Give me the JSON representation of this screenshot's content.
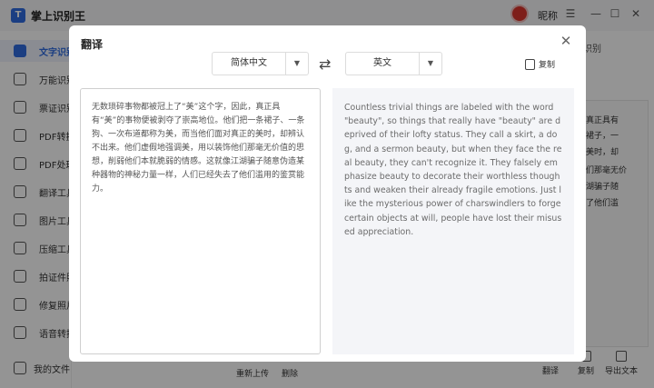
{
  "app": {
    "logo_char": "T",
    "title": "掌上识别王",
    "nickname": "昵称",
    "window_buttons": [
      "☰",
      "—",
      "☐",
      "✕"
    ]
  },
  "sidebar": {
    "items": [
      {
        "label": "文字识别",
        "icon": "text-recognition-icon",
        "active": true
      },
      {
        "label": "万能识别",
        "icon": "universal-scan-icon"
      },
      {
        "label": "票证识别",
        "icon": "ticket-icon"
      },
      {
        "label": "PDF转换",
        "icon": "pdf-convert-icon"
      },
      {
        "label": "PDF处理",
        "icon": "pdf-process-icon"
      },
      {
        "label": "翻译工具",
        "icon": "translate-icon"
      },
      {
        "label": "图片工具",
        "icon": "image-tool-icon"
      },
      {
        "label": "压缩工具",
        "icon": "compress-icon"
      },
      {
        "label": "拍证件照",
        "icon": "id-photo-icon"
      },
      {
        "label": "修复照片",
        "icon": "repair-photo-icon"
      },
      {
        "label": "语音转换",
        "icon": "voice-icon"
      }
    ],
    "my_files": "我的文件"
  },
  "background": {
    "tab_label": "识别",
    "text_lines": [
      "，真正具有",
      "条裙子，一",
      "的美时，却",
      "他们那毫无价",
      "江湖骗子随",
      "去了他们滥"
    ],
    "bottom_links": [
      "重新上传",
      "删除"
    ],
    "bottom_tools": [
      "翻译",
      "复制",
      "导出文本"
    ]
  },
  "dialog": {
    "title": "翻译",
    "close_icon": "✕",
    "source_lang": "简体中文",
    "target_lang": "英文",
    "swap_icon": "⇄",
    "copy_label": "复制",
    "source_text": "无数琐碎事物都被冠上了“美”这个字，因此，真正具有“美”的事物便被剥夺了崇高地位。他们把一条裙子、一条狗、一次布道都称为美，而当他们面对真正的美时，却辨认不出来。他们虚假地强调美，用以装饰他们那毫无价值的思想，削弱他们本就脆弱的情感。这就像江湖骗子随意伪造某种器物的神秘力量一样，人们已经失去了他们滥用的鉴赏能力。",
    "translated_text": "Countless trivial things are labeled with the word \"beauty\", so things that really have \"beauty\" are deprived of their lofty status. They call a skirt, a dog, and a sermon beauty, but when they face the real beauty, they can't recognize it. They falsely emphasize beauty to decorate their worthless thoughts and weaken their already fragile emotions. Just like the mysterious power of charswindlers to forge certain objects at will, people have lost their misused appreciation."
  }
}
